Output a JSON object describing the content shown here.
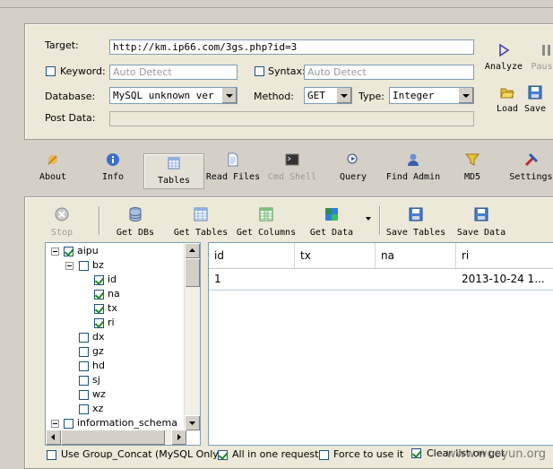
{
  "target": {
    "label": "Target:",
    "value": "http://km.ip66.com/3gs.php?id=3"
  },
  "keyword": {
    "label": "Keyword:",
    "placeholder": "Auto Detect",
    "checked": false
  },
  "syntax": {
    "label": "Syntax:",
    "placeholder": "Auto Detect",
    "checked": false
  },
  "database": {
    "label": "Database:",
    "selected": "MySQL unknown ver"
  },
  "method": {
    "label": "Method:",
    "selected": "GET"
  },
  "type": {
    "label": "Type:",
    "selected": "Integer"
  },
  "post_data": {
    "label": "Post Data:",
    "value": ""
  },
  "side_buttons": {
    "analyze": "Analyze",
    "pause": "Paus",
    "load": "Load",
    "save": "Save"
  },
  "toolbar": {
    "about": "About",
    "info": "Info",
    "tables": "Tables",
    "read_files": "Read Files",
    "cmd_shell": "Cmd Shell",
    "query": "Query",
    "find_admin": "Find Admin",
    "md5": "MD5",
    "settings": "Settings"
  },
  "tables_toolbar": {
    "stop": "Stop",
    "get_dbs": "Get DBs",
    "get_tables": "Get Tables",
    "get_columns": "Get Columns",
    "get_data": "Get Data",
    "save_tables": "Save Tables",
    "save_data": "Save Data"
  },
  "tree": {
    "db": "aipu",
    "table": "bz",
    "columns": [
      "id",
      "na",
      "tx",
      "ri"
    ],
    "other_tables": [
      "dx",
      "gz",
      "hd",
      "sj",
      "wz",
      "xz"
    ],
    "other_db": "information_schema"
  },
  "grid": {
    "columns": [
      "id",
      "tx",
      "na",
      "ri"
    ],
    "rows": [
      [
        "1",
        "",
        "",
        "2013-10-24 1..."
      ]
    ]
  },
  "options": {
    "group_concat": "Use Group_Concat (MySQL Only)",
    "all_in_one": "All in one request.",
    "force": "Force to use it",
    "clear_list": "Clear list on get"
  },
  "watermark": "www.wooyun.org",
  "colors": {
    "accent": "#316ac5",
    "panel": "#ece9d8",
    "window": "#d4d0c8"
  }
}
